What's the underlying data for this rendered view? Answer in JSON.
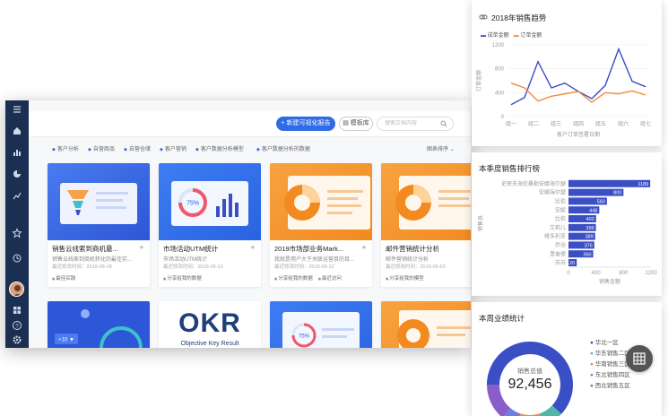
{
  "sidebar": {
    "icons": [
      "menu-icon",
      "home-icon",
      "bar-chart-icon",
      "pie-chart-icon",
      "line-chart-icon",
      "star-icon",
      "clock-icon",
      "grid-icon",
      "help-icon",
      "settings-icon"
    ]
  },
  "toolbar": {
    "new_report": "新建可视化报告",
    "template": "模板库",
    "search_placeholder": "搜索文档内容"
  },
  "filters": [
    "客户分析",
    "自营商品",
    "自营仓储",
    "客户营销",
    "客户数据分析模型",
    "客户数据分析的数据"
  ],
  "sort_label": "图表排序",
  "cards": [
    {
      "title": "销售云线索到商机最...",
      "desc": "销售云线索到商机转化的最佳实...",
      "date": "最近修改时间：2019-09-18",
      "tags": [
        "最佳实践"
      ],
      "theme": "funnel"
    },
    {
      "title": "市场活动UTM统计",
      "desc": "市场活动UTM统计",
      "date": "最近修改时间：2019-09-12",
      "tags": [
        "分享给我的数据"
      ],
      "theme": "gauge",
      "gauge_label": "75%"
    },
    {
      "title": "2019市场部业务Mark...",
      "desc": "我就是用户大于关联运营目的目...",
      "date": "最近修改时间：2019-09-12",
      "tags": [
        "分享给我的数据",
        "最近访问"
      ],
      "theme": "donut"
    },
    {
      "title": "邮件营销统计分析",
      "desc": "邮件营销统计分析",
      "date": "最近修改时间：2019-09-03",
      "tags": [
        "分享给我的模型"
      ],
      "theme": "donut2"
    },
    {
      "theme": "speed",
      "badge": "+10 ▼"
    },
    {
      "theme": "okr",
      "okr_text": "OKR",
      "okr_sub": "Objective Key Result"
    },
    {
      "theme": "gauge2",
      "gauge_label": "75%"
    },
    {
      "theme": "donut3"
    }
  ],
  "trend": {
    "title": "2018年销售趋势",
    "legend": [
      "成单金额",
      "订单金额"
    ],
    "ylabel": "订单金额",
    "xlabel": "客户订单签署日期",
    "colors": {
      "a": "#3b4fc4",
      "b": "#f5893d"
    }
  },
  "rank": {
    "title": "本季度销售排行榜",
    "ylabel": "销售员",
    "xlabel": "销售金额"
  },
  "weekly": {
    "title": "本周业绩统计",
    "center_label": "销售总值",
    "center_value": "92,456",
    "legend": [
      {
        "name": "华北一区",
        "color": "#3b4fc4"
      },
      {
        "name": "华东销售二区",
        "color": "#52b5a8"
      },
      {
        "name": "华南销售三区",
        "color": "#f5893d"
      },
      {
        "name": "东北销售四区",
        "color": "#6e7fe0"
      },
      {
        "name": "西北销售五区",
        "color": "#8a5ec9"
      }
    ]
  },
  "chart_data": [
    {
      "type": "line",
      "title": "2018年销售趋势",
      "categories": [
        "组一",
        "组二",
        "组三",
        "组四",
        "组五",
        "组六",
        "组七"
      ],
      "series": [
        {
          "name": "成单金额",
          "values": [
            200,
            320,
            920,
            480,
            560,
            420,
            300,
            520,
            1130,
            590,
            500
          ]
        },
        {
          "name": "订单金额",
          "values": [
            560,
            480,
            260,
            340,
            380,
            420,
            240,
            400,
            380,
            430,
            360
          ]
        }
      ],
      "ylim": [
        0,
        1200
      ],
      "yticks": [
        0,
        400,
        800,
        1200
      ],
      "xlabel": "客户订单签署日期",
      "ylabel": "订单金额"
    },
    {
      "type": "bar",
      "title": "本季度销售排行榜",
      "categories": [
        "史密夫海伦桑勒安娜海尔瑟",
        "安娜海尔瑟",
        "比伯",
        "安妮",
        "比伯",
        "艾莉儿",
        "维多利亚",
        "乔治",
        "里查德",
        "苏苏"
      ],
      "values": [
        1189,
        800,
        560,
        448,
        402,
        399,
        389,
        376,
        360,
        120
      ],
      "xlim": [
        0,
        1200
      ],
      "xticks": [
        0,
        400,
        800,
        1200
      ],
      "xlabel": "销售金额",
      "ylabel": "销售员"
    },
    {
      "type": "pie",
      "title": "本周业绩统计",
      "categories": [
        "华北一区",
        "华东销售二区",
        "华南销售三区",
        "东北销售四区",
        "西北销售五区"
      ],
      "values": [
        62,
        8,
        10,
        6,
        14
      ]
    }
  ]
}
